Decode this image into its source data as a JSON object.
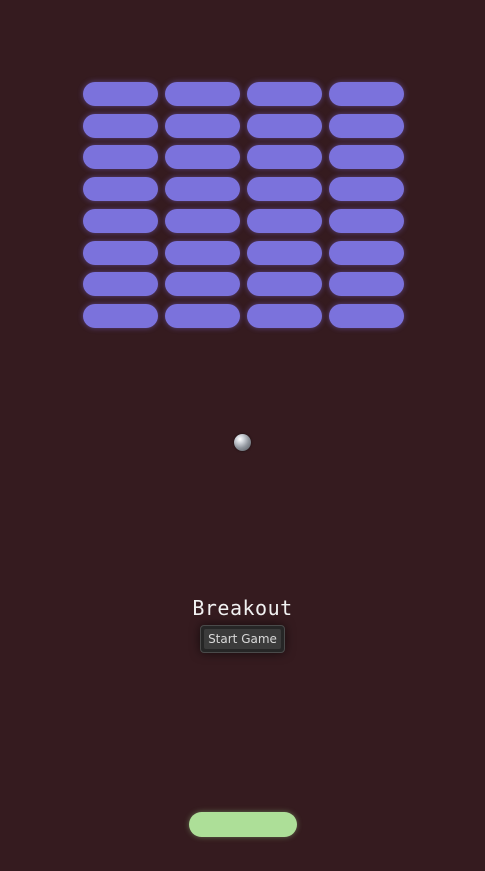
{
  "game": {
    "title": "Breakout",
    "start_button_label": "Start Game",
    "brick_rows": 8,
    "brick_columns": 4,
    "colors": {
      "background": "#351b1f",
      "brick": "#7b72dc",
      "paddle": "#addf98",
      "ball": "#b9bec6"
    }
  }
}
